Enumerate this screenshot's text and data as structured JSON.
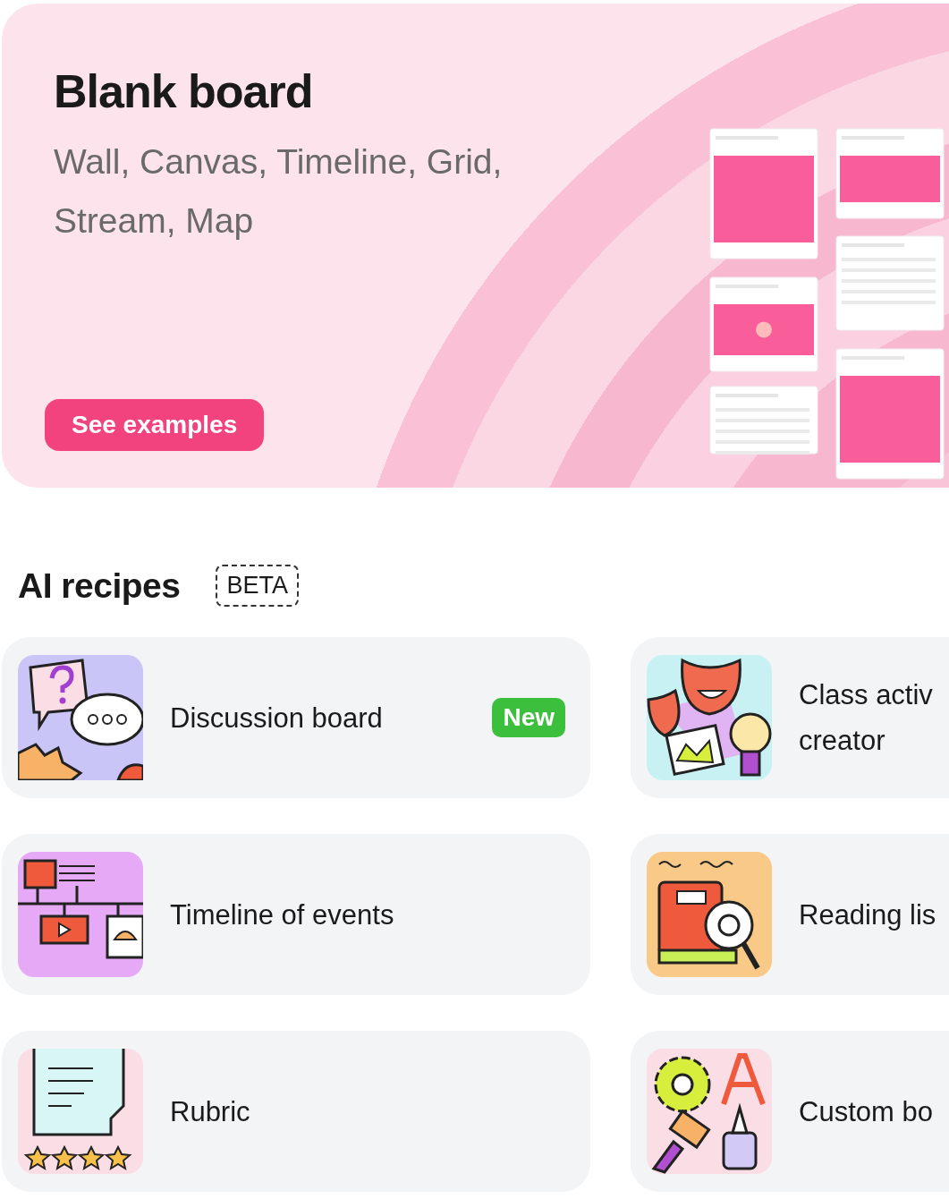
{
  "hero": {
    "title": "Blank board",
    "subtitle": "Wall, Canvas, Timeline, Grid, Stream, Map",
    "button": "See examples"
  },
  "section": {
    "title": "AI recipes",
    "badge": "BETA"
  },
  "recipe_rows": [
    {
      "cards": [
        {
          "kind": "discussion",
          "label": "Discussion board",
          "badge": "New"
        },
        {
          "kind": "activity",
          "label": "Class activ creator"
        }
      ]
    },
    {
      "cards": [
        {
          "kind": "timeline",
          "label": "Timeline of events"
        },
        {
          "kind": "reading",
          "label": "Reading lis"
        }
      ]
    },
    {
      "cards": [
        {
          "kind": "rubric",
          "label": "Rubric"
        },
        {
          "kind": "custom",
          "label": "Custom bo"
        }
      ]
    }
  ]
}
